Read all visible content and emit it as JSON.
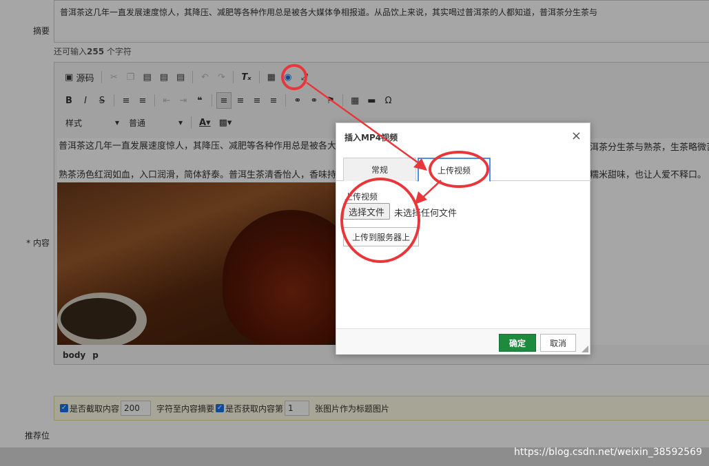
{
  "form": {
    "summary_label": "摘要",
    "summary_text": "普洱茶这几年一直发展速度惊人，其降压、减肥等各种作用总是被各大媒体争相报道。从品饮上来说，其实喝过普洱茶的人都知道，普洱茶分生茶与",
    "counter_prefix": "还可输入",
    "counter_value": "255",
    "counter_suffix": "个字符",
    "content_label": "* 内容",
    "recommend_label": "推荐位"
  },
  "toolbar": {
    "source_label": "源码",
    "style_combo": "样式",
    "format_combo": "普通"
  },
  "editor": {
    "para1_left": "普洱茶这几年一直发展速度惊人，其降压、减肥等各种作用总是被各大",
    "para1_right": "洱茶分生茶与熟茶，生茶略微苦",
    "para2_left": "熟茶汤色红润如血，入口润滑，简体舒泰。普洱生茶清香怡人，香味持",
    "para2_right": "糯米甜味，也让人爱不释口。",
    "path_body": "body",
    "path_p": "p"
  },
  "options": {
    "check1_label": "是否截取内容",
    "check1_value": "200",
    "check1_suffix": "字符至内容摘要",
    "check2_label": "是否获取内容第",
    "check2_value": "1",
    "check2_suffix": "张图片作为标题图片"
  },
  "dialog": {
    "title": "插入MP4视频",
    "close": "×",
    "tab_general": "常规",
    "tab_upload": "上传视频",
    "field_label": "上传视频",
    "choose_file": "选择文件",
    "no_file": "未选择任何文件",
    "upload_server": "上传到服务器上",
    "ok": "确定",
    "cancel": "取消"
  },
  "watermark": "https://blog.csdn.net/weixin_38592569",
  "colors": {
    "ok_button": "#1e8a3e",
    "annotation": "#e8373b",
    "active_tab_border": "#4a90e2"
  }
}
